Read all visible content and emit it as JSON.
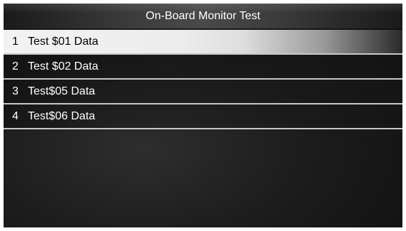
{
  "header": {
    "title": "On-Board Monitor Test"
  },
  "menu": {
    "items": [
      {
        "number": "1",
        "label": "Test $01 Data",
        "selected": true
      },
      {
        "number": "2",
        "label": "Test $02 Data",
        "selected": false
      },
      {
        "number": "3",
        "label": "Test$05 Data",
        "selected": false
      },
      {
        "number": "4",
        "label": "Test$06 Data",
        "selected": false
      }
    ]
  },
  "colors": {
    "background": "#141414",
    "selected_highlight": "#f0f0f0",
    "divider": "#c8c8c8",
    "text": "#ffffff"
  }
}
